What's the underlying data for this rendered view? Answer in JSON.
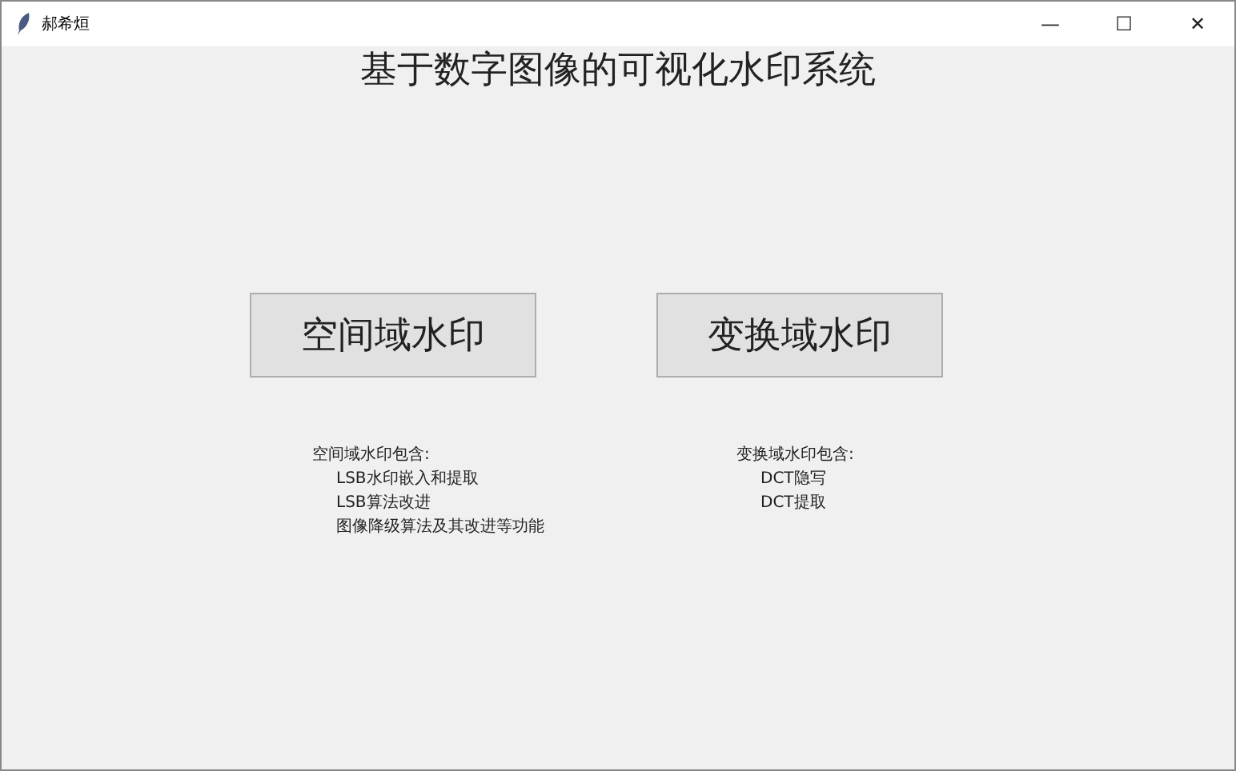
{
  "window": {
    "title": "郝希烜",
    "controls": [
      "—",
      "☐",
      "✕"
    ]
  },
  "heading": "基于数字图像的可视化水印系统",
  "buttons": [
    "空间域水印",
    "变换域水印"
  ],
  "descriptions": [
    {
      "title": "空间域水印包含:",
      "items": [
        "LSB水印嵌入和提取",
        "LSB算法改进",
        "图像降级算法及其改进等功能"
      ]
    },
    {
      "title": "变换域水印包含:",
      "items": [
        "DCT隐写",
        "DCT提取"
      ]
    }
  ]
}
